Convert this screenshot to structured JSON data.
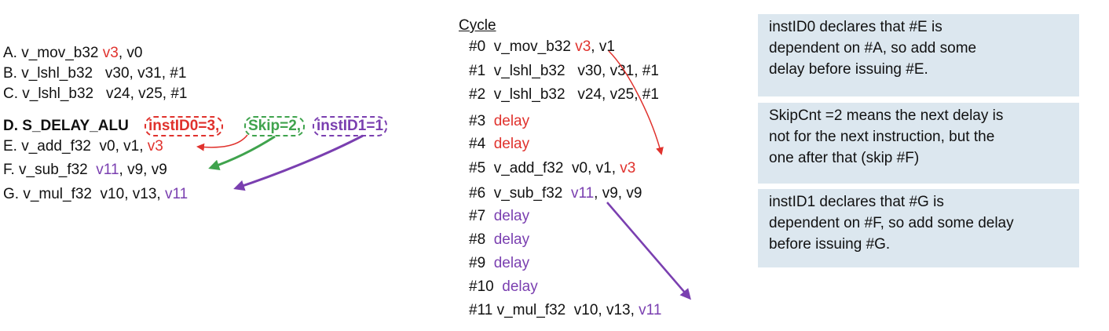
{
  "left_code": {
    "line_a": {
      "prefix": "A. v_mov_b32 ",
      "reg": "v3",
      "suffix": ", v0"
    },
    "line_b": "B. v_lshl_b32   v30, v31, #1",
    "line_c": "C. v_lshl_b32   v24, v25, #1",
    "line_d": {
      "prefix": "D. S_DELAY_ALU ",
      "inst0": "instID0=3,",
      "skip": "Skip=2,",
      "inst1": "instID1=1"
    },
    "line_e": {
      "prefix": "E. v_add_f32  v0, v1, ",
      "reg": "v3"
    },
    "line_f": {
      "prefix": "F. v_sub_f32  ",
      "reg": "v11",
      "suffix": ", v9, v9"
    },
    "line_g": {
      "prefix": "G. v_mul_f32  v10, v13, ",
      "reg": "v11"
    }
  },
  "cycle_heading": "Cycle",
  "cycles": {
    "c0": {
      "prefix": "#0  v_mov_b32 ",
      "reg": "v3",
      "suffix": ", v1"
    },
    "c1": "#1  v_lshl_b32   v30, v31, #1",
    "c2": "#2  v_lshl_b32   v24, v25, #1",
    "c3": {
      "num": "#3  ",
      "text": "delay"
    },
    "c4": {
      "num": "#4  ",
      "text": "delay"
    },
    "c5": {
      "prefix": "#5  v_add_f32  v0, v1, ",
      "reg": "v3"
    },
    "c6": {
      "prefix": "#6  v_sub_f32  ",
      "reg": "v11",
      "suffix": ", v9, v9"
    },
    "c7": {
      "num": "#7  ",
      "text": "delay"
    },
    "c8": {
      "num": "#8  ",
      "text": "delay"
    },
    "c9": {
      "num": "#9  ",
      "text": "delay"
    },
    "c10": {
      "num": "#10  ",
      "text": "delay"
    },
    "c11": {
      "prefix": "#11 v_mul_f32  v10, v13, ",
      "reg": "v11"
    }
  },
  "notes": [
    "instID0 declares that #E is\ndependent on #A, so add some\ndelay before issuing #E.",
    "SkipCnt =2 means the next delay is\nnot for the next instruction, but the\none after that (skip #F)",
    "instID1 declares that #G is\ndependent on #F, so add some delay\nbefore issuing #G."
  ],
  "colors": {
    "red": "#e0322d",
    "green": "#3fa34d",
    "purple": "#7a3fb0",
    "note_bg": "#dce7ef"
  }
}
